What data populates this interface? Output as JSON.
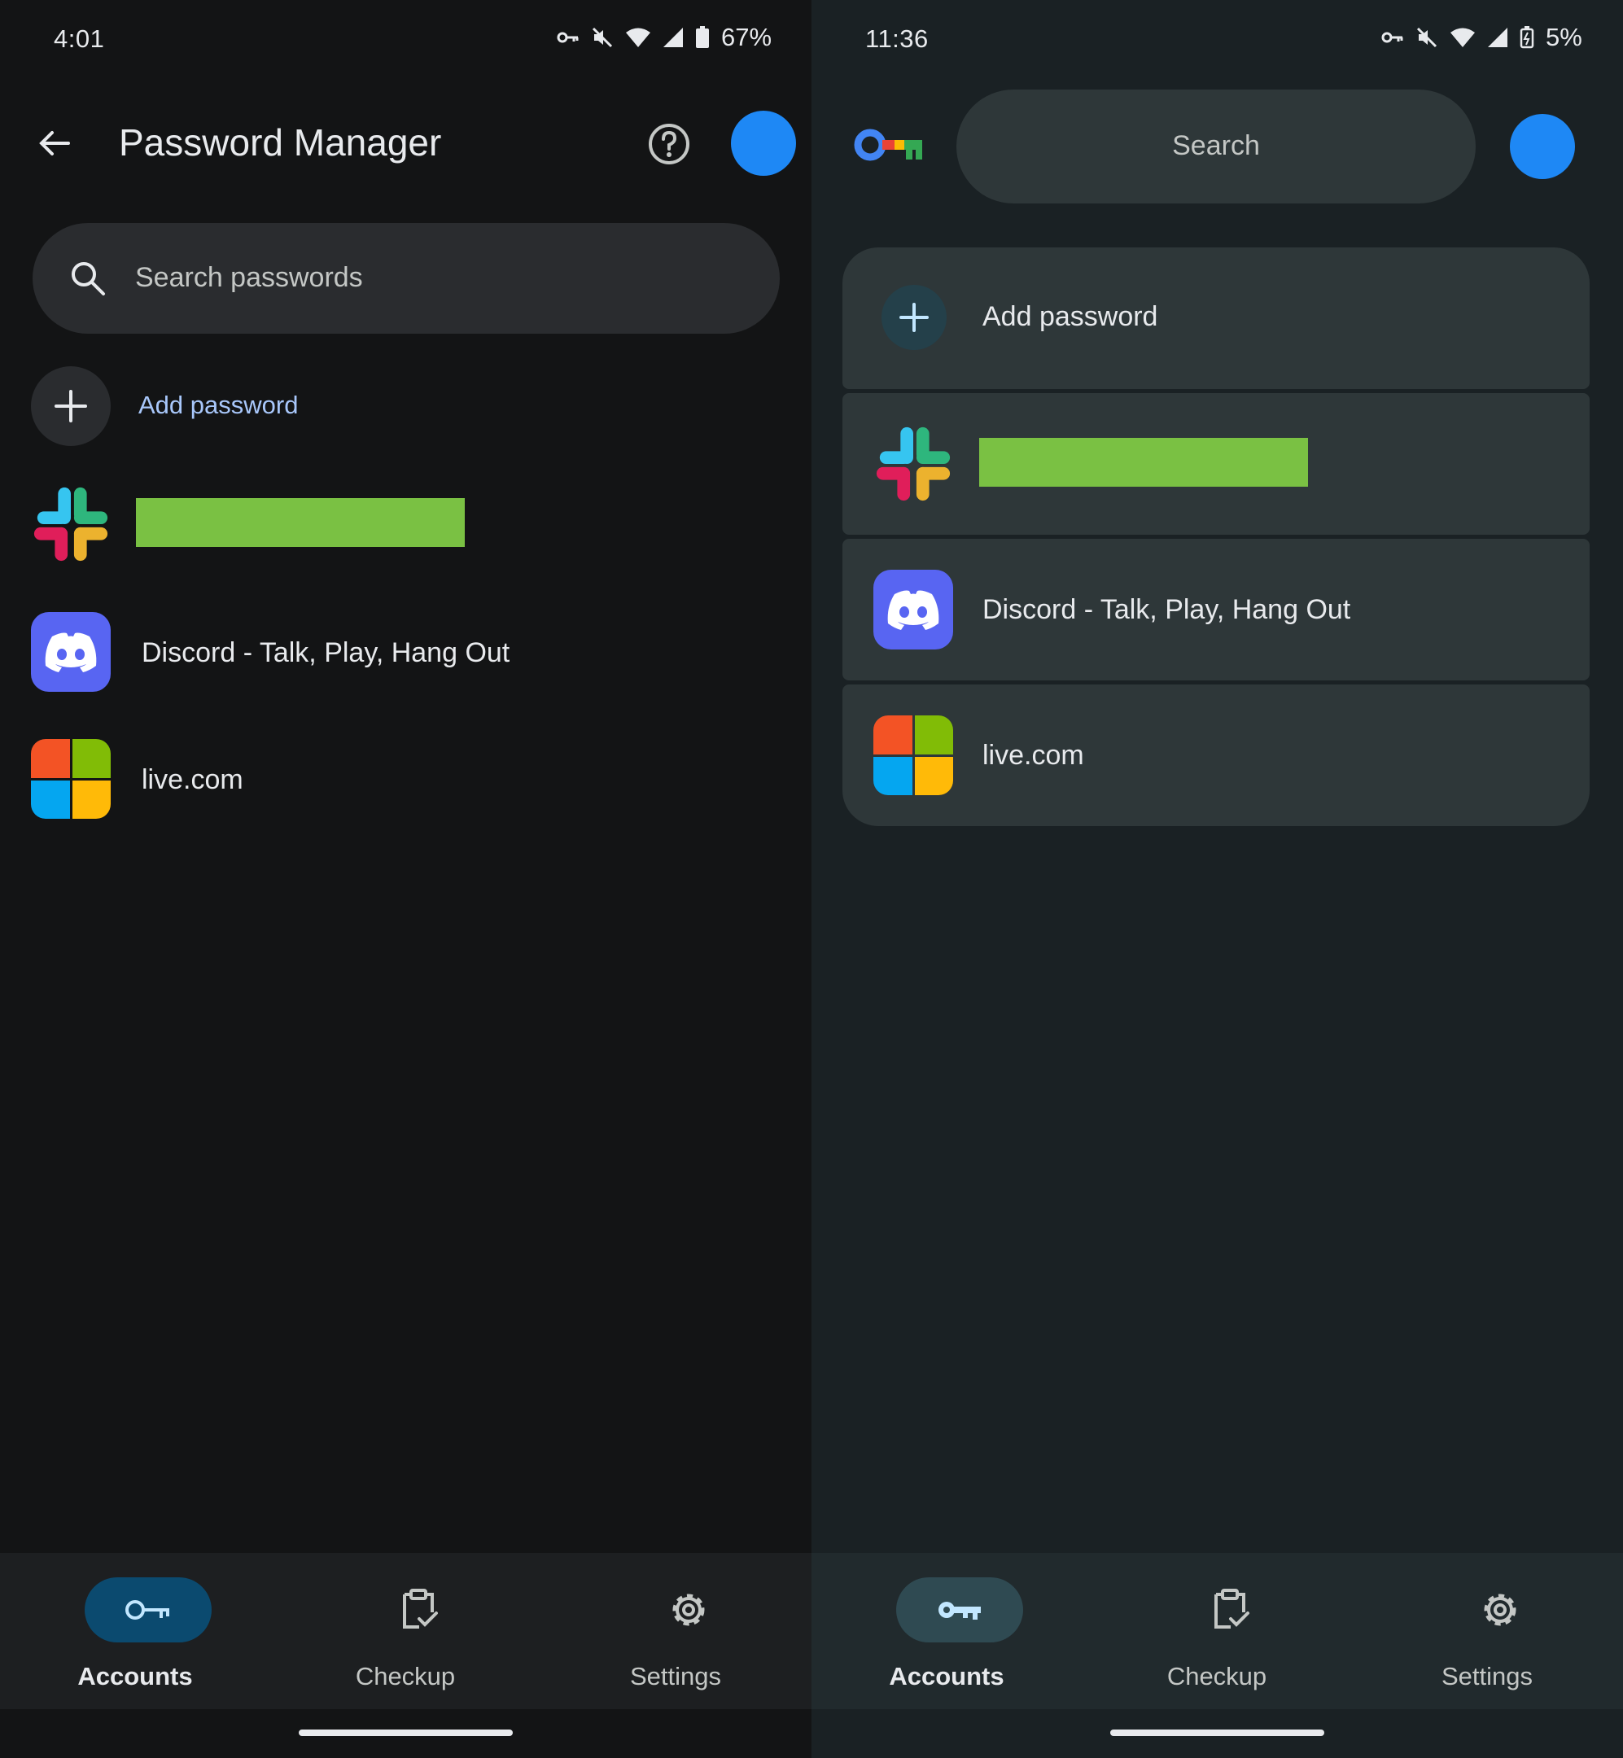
{
  "left": {
    "status": {
      "time": "4:01",
      "battery": "67%"
    },
    "header": {
      "title": "Password Manager"
    },
    "search": {
      "placeholder": "Search passwords"
    },
    "add_password": {
      "label": "Add password"
    },
    "items": [
      {
        "title": "",
        "icon": "slack-icon"
      },
      {
        "title": "Discord - Talk, Play, Hang Out",
        "icon": "discord-icon"
      },
      {
        "title": "live.com",
        "icon": "microsoft-icon"
      }
    ],
    "nav": [
      {
        "label": "Accounts",
        "icon": "key-icon",
        "active": true
      },
      {
        "label": "Checkup",
        "icon": "checkup-icon",
        "active": false
      },
      {
        "label": "Settings",
        "icon": "gear-icon",
        "active": false
      }
    ]
  },
  "right": {
    "status": {
      "time": "11:36",
      "battery": "5%"
    },
    "search": {
      "placeholder": "Search"
    },
    "add_password": {
      "label": "Add password"
    },
    "items": [
      {
        "title": "",
        "icon": "slack-icon"
      },
      {
        "title": "Discord - Talk, Play, Hang Out",
        "icon": "discord-icon"
      },
      {
        "title": "live.com",
        "icon": "microsoft-icon"
      }
    ],
    "nav": [
      {
        "label": "Accounts",
        "icon": "key-icon",
        "active": true
      },
      {
        "label": "Checkup",
        "icon": "checkup-icon",
        "active": false
      },
      {
        "label": "Settings",
        "icon": "gear-icon",
        "active": false
      }
    ]
  },
  "colors": {
    "accent_blue": "#1e88f5",
    "link_blue": "#a8c7fa",
    "redaction_green": "#7ac143",
    "left_bg": "#131415",
    "right_bg": "#1a2124",
    "discord": "#5865f2"
  }
}
